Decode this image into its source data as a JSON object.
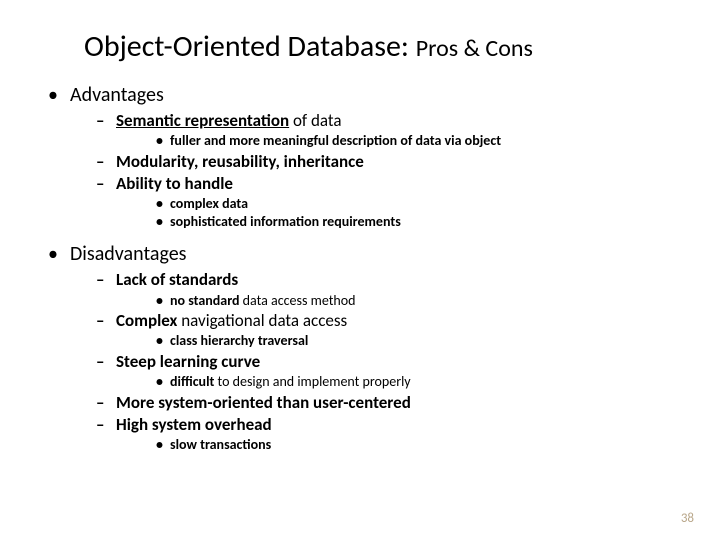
{
  "title": {
    "main": "Object-Oriented Database: ",
    "sub": "Pros & Cons"
  },
  "adv": {
    "heading": "Advantages",
    "semantic_u": "Semantic representation",
    "semantic_rest": " of data",
    "fuller": "fuller and more meaningful description of data via object",
    "modularity": "Modularity, reusability, inheritance",
    "ability": "Ability to handle",
    "complex_data": "complex data",
    "sophisticated": "sophisticated information requirements"
  },
  "dis": {
    "heading": "Disadvantages",
    "lack": "Lack of standards",
    "no_standard_b": "no standard",
    "no_standard_rest": " data access method",
    "complex_b": "Complex",
    "complex_rest": " navigational data access",
    "class_hierarchy": "class hierarchy traversal",
    "steep": "Steep learning curve",
    "difficult_b": "difficult",
    "difficult_rest": " to design and implement properly",
    "system_oriented": "More system-oriented than user-centered",
    "overhead": "High system overhead",
    "slow": "slow transactions"
  },
  "page": "38"
}
